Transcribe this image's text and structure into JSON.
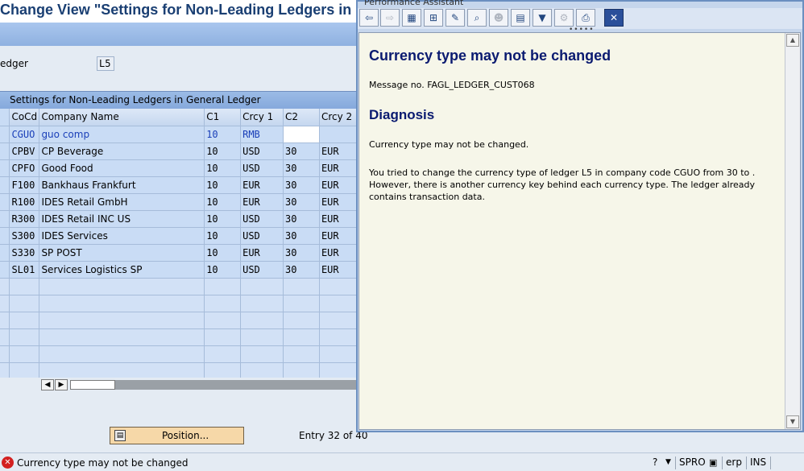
{
  "window": {
    "title": "Change View \"Settings for Non-Leading Ledgers in G"
  },
  "ledger": {
    "label": "edger",
    "value": "L5"
  },
  "table": {
    "caption": "Settings for Non-Leading Ledgers in General Ledger",
    "headers": [
      "CoCd",
      "Company Name",
      "C1",
      "Crcy 1",
      "C2",
      "Crcy 2"
    ],
    "rows": [
      [
        "CGUO",
        "guo comp",
        "10",
        "RMB",
        "",
        ""
      ],
      [
        "CPBV",
        "CP Beverage",
        "10",
        "USD",
        "30",
        "EUR"
      ],
      [
        "CPFO",
        "Good Food",
        "10",
        "USD",
        "30",
        "EUR"
      ],
      [
        "F100",
        "Bankhaus Frankfurt",
        "10",
        "EUR",
        "30",
        "EUR"
      ],
      [
        "R100",
        "IDES Retail GmbH",
        "10",
        "EUR",
        "30",
        "EUR"
      ],
      [
        "R300",
        "IDES Retail INC US",
        "10",
        "USD",
        "30",
        "EUR"
      ],
      [
        "S300",
        "IDES Services",
        "10",
        "USD",
        "30",
        "EUR"
      ],
      [
        "S330",
        "SP POST",
        "10",
        "EUR",
        "30",
        "EUR"
      ],
      [
        "SL01",
        "Services Logistics SP",
        "10",
        "USD",
        "30",
        "EUR"
      ]
    ]
  },
  "footer": {
    "position_label": "Position...",
    "entry_text": "Entry 32 of 40"
  },
  "status": {
    "message": "Currency type may not be changed",
    "transaction": "SPRO",
    "system": "erp",
    "mode": "INS"
  },
  "popup": {
    "title": "Performance Assistant",
    "heading": "Currency type may not be changed",
    "message_no": "Message no. FAGL_LEDGER_CUST068",
    "diagnosis_heading": "Diagnosis",
    "diagnosis_short": "Currency type may not be changed.",
    "diagnosis_long": "You tried to change the currency type of ledger L5 in company code CGUO from 30 to . However, there is another currency key behind each currency type. The ledger already contains transaction data."
  },
  "colors": {
    "accent": "#1a3f73",
    "popup_heading": "#0a1a70",
    "error": "#d32020"
  }
}
